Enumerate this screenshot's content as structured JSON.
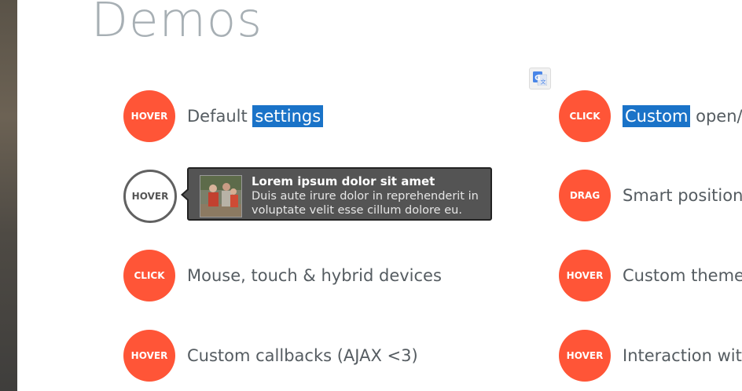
{
  "page": {
    "title": "Demos"
  },
  "icons": {
    "translate": "google-translate-icon"
  },
  "colors": {
    "accent": "#ff5537",
    "outline": "#616161",
    "selection": "#1a73c8",
    "title": "#a7afb4",
    "tooltip_bg": "#545454"
  },
  "demos": [
    {
      "trigger": "HOVER",
      "label_plain": "Default ",
      "label_selected": "settings",
      "label_rest": ""
    },
    {
      "trigger": "HOVER",
      "label": ""
    },
    {
      "trigger": "CLICK",
      "label": "Mouse, touch & hybrid devices"
    },
    {
      "trigger": "HOVER",
      "label": "Custom callbacks (AJAX <3)"
    },
    {
      "trigger": "CLICK",
      "label_plain": "",
      "label_selected": "Custom",
      "label_rest": " open/c"
    },
    {
      "trigger": "DRAG",
      "label": "Smart position"
    },
    {
      "trigger": "HOVER",
      "label": "Custom theme"
    },
    {
      "trigger": "HOVER",
      "label": "Interaction wit"
    }
  ],
  "tooltip": {
    "title": "Lorem ipsum dolor sit amet",
    "body": "Duis aute irure dolor in reprehenderit in voluptate velit esse cillum dolore eu."
  }
}
